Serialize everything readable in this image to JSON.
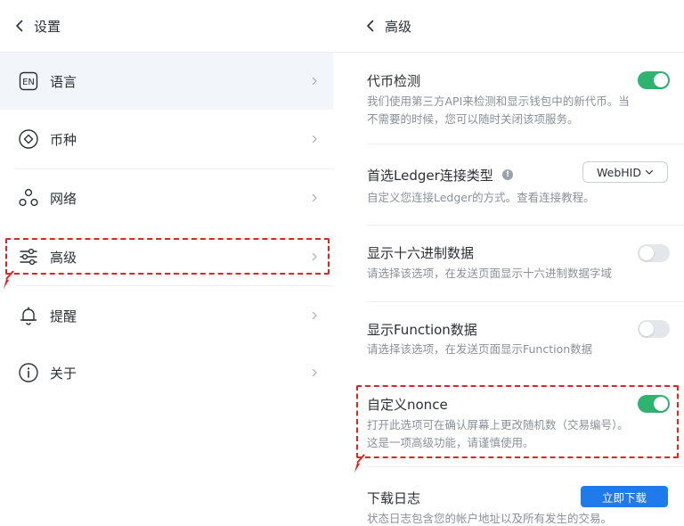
{
  "left_panel": {
    "header": {
      "title": "设置",
      "back_icon": "chevron-left-icon"
    },
    "menu": [
      {
        "key": "language",
        "label": "语言",
        "icon": "language-en-icon"
      },
      {
        "key": "currency",
        "label": "币种",
        "icon": "currency-icon"
      },
      {
        "key": "network",
        "label": "网络",
        "icon": "network-icon"
      },
      {
        "key": "advanced",
        "label": "高级",
        "icon": "sliders-icon"
      },
      {
        "key": "reminder",
        "label": "提醒",
        "icon": "bell-icon"
      },
      {
        "key": "about",
        "label": "关于",
        "icon": "info-icon"
      }
    ],
    "selected": "language",
    "highlighted": "advanced"
  },
  "right_panel": {
    "header": {
      "title": "高级",
      "back_icon": "chevron-left-icon"
    },
    "settings": {
      "token_detection": {
        "title": "代币检测",
        "desc_line1": "我们使用第三方API来检测和显示钱包中的新代币。当",
        "desc_line2": "不需要的时候，您可以随时关闭该项服务。",
        "enabled": true
      },
      "ledger_connection": {
        "title": "首选Ledger连接类型",
        "info_glyph": "!",
        "select_value": "WebHID",
        "desc": "自定义您连接Ledger的方式。查看连接教程。"
      },
      "hex_data": {
        "title": "显示十六进制数据",
        "desc": "请选择该选项，在发送页面显示十六进制数据字域",
        "enabled": false
      },
      "function_data": {
        "title": "显示Function数据",
        "desc": "请选择该选项，在发送页面显示Function数据",
        "enabled": false
      },
      "custom_nonce": {
        "title": "自定义nonce",
        "desc_line1": "打开此选项可在确认屏幕上更改随机数（交易编号）。",
        "desc_line2": "这是一项高级功能，请谨慎使用。",
        "enabled": true
      },
      "download_logs": {
        "title": "下载日志",
        "desc": "状态日志包含您的帐户地址以及所有发生的交易。",
        "button_label": "立即下载"
      }
    }
  },
  "colors": {
    "toggle_on": "#2fb470",
    "toggle_off": "#e3e6ea",
    "primary_button": "#1f7aec",
    "annotation_red": "#e02424",
    "selected_row": "#f2f5f9"
  }
}
